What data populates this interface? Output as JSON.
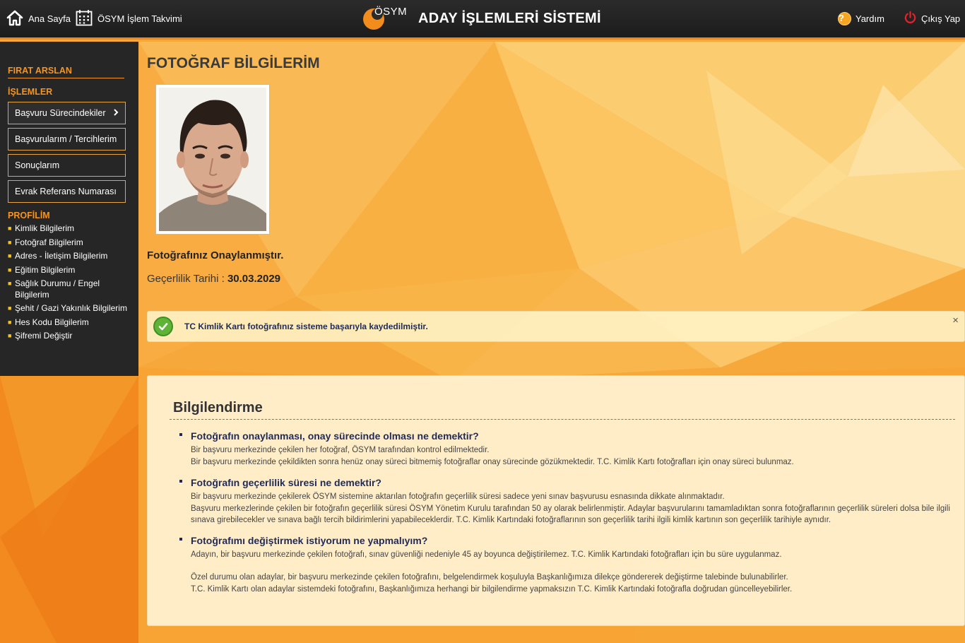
{
  "header": {
    "home_label": "Ana Sayfa",
    "calendar_label": "ÖSYM İşlem Takvimi",
    "logo_text": "ÖSYM",
    "system_title": "ADAY İŞLEMLERİ SİSTEMİ",
    "help_label": "Yardım",
    "logout_label": "Çıkış Yap"
  },
  "sidebar": {
    "user_name": "FIRAT ARSLAN",
    "operations_title": "İŞLEMLER",
    "operations": [
      {
        "label": "Başvuru Sürecindekiler"
      },
      {
        "label": "Başvurularım / Tercihlerim"
      },
      {
        "label": "Sonuçlarım"
      },
      {
        "label": "Evrak Referans Numarası"
      }
    ],
    "profile_title": "PROFİLİM",
    "profile_links": [
      {
        "label": "Kimlik Bilgilerim"
      },
      {
        "label": "Fotoğraf Bilgilerim"
      },
      {
        "label": "Adres - İletişim Bilgilerim"
      },
      {
        "label": "Eğitim Bilgilerim"
      },
      {
        "label": "Sağlık Durumu / Engel Bilgilerim"
      },
      {
        "label": "Şehit / Gazi Yakınlık Bilgilerim"
      },
      {
        "label": "Hes Kodu Bilgilerim"
      },
      {
        "label": "Şifremi Değiştir"
      }
    ]
  },
  "main": {
    "page_title": "FOTOĞRAF BİLGİLERİM",
    "approved_text": "Fotoğrafınız Onaylanmıştır.",
    "validity_label": "Geçerlilik Tarihi :",
    "validity_date": "30.03.2029",
    "alert_message": "TC Kimlik Kartı fotoğrafınız sisteme başarıyla kaydedilmiştir.",
    "alert_close": "×"
  },
  "info": {
    "title": "Bilgilendirme",
    "questions": [
      {
        "title": "Fotoğrafın onaylanması, onay sürecinde olması ne demektir?",
        "lines": [
          "Bir başvuru merkezinde çekilen her fotoğraf, ÖSYM tarafından kontrol edilmektedir.",
          "Bir başvuru merkezinde çekildikten sonra henüz onay süreci bitmemiş fotoğraflar onay sürecinde gözükmektedir. T.C. Kimlik Kartı fotoğrafları için onay süreci bulunmaz."
        ]
      },
      {
        "title": "Fotoğrafın geçerlilik süresi ne demektir?",
        "lines": [
          "Bir başvuru merkezinde çekilerek ÖSYM sistemine aktarılan fotoğrafın geçerlilik süresi sadece yeni sınav başvurusu esnasında dikkate alınmaktadır.",
          "Başvuru merkezlerinde çekilen bir fotoğrafın geçerlilik süresi ÖSYM Yönetim Kurulu tarafından 50 ay olarak belirlenmiştir. Adaylar başvurularını tamamladıktan sonra fotoğraflarının geçerlilik süreleri dolsa bile ilgili sınava girebilecekler ve sınava bağlı tercih bildirimlerini yapabileceklerdir. T.C. Kimlik Kartındaki fotoğraflarının son geçerlilik tarihi ilgili kimlik kartının son geçerlilik tarihiyle aynıdır."
        ]
      },
      {
        "title": "Fotoğrafımı değiştirmek istiyorum ne yapmalıyım?",
        "lines": [
          "Adayın, bir başvuru merkezinde çekilen fotoğrafı, sınav güvenliği nedeniyle 45 ay boyunca değiştirilemez. T.C. Kimlik Kartındaki fotoğrafları için bu süre uygulanmaz.",
          "Özel durumu olan adaylar, bir başvuru merkezinde çekilen fotoğrafını, belgelendirmek koşuluyla Başkanlığımıza dilekçe göndererek değiştirme talebinde bulunabilirler.",
          "T.C. Kimlik Kartı olan adaylar sistemdeki fotoğrafını, Başkanlığımıza herhangi bir bilgilendirme yapmaksızın T.C. Kimlik Kartındaki fotoğrafla doğrudan güncelleyebilirler."
        ]
      }
    ]
  },
  "colors": {
    "accent": "#f7941d",
    "header_bg": "#222222",
    "sidebar_bg": "#262626",
    "question_title": "#1f2a5a",
    "success_green": "#5fb336"
  }
}
